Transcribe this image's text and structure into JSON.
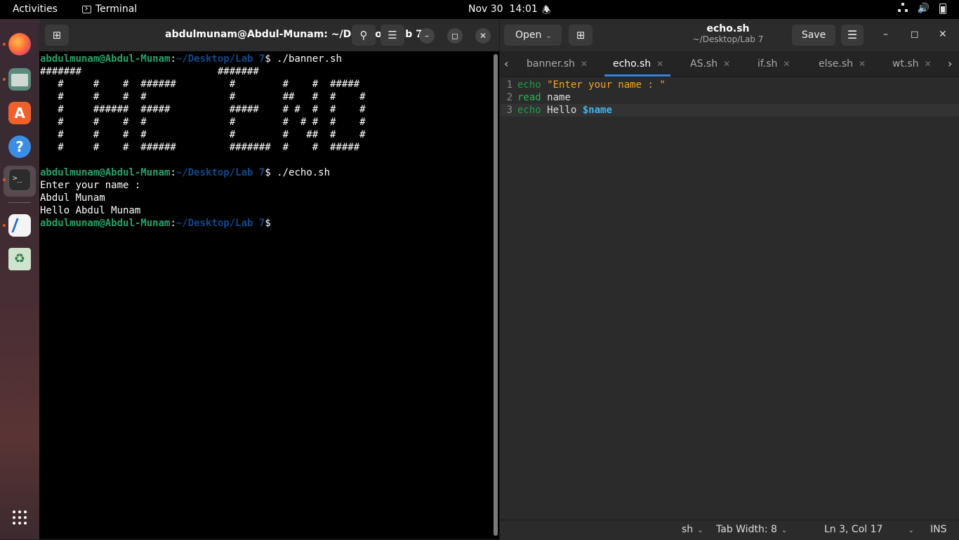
{
  "topbar": {
    "activities": "Activities",
    "app_name": "Terminal",
    "datetime": "Nov 30  14:01"
  },
  "dock": {
    "items": [
      "Firefox",
      "Files",
      "App Center",
      "Help",
      "Terminal",
      "Text Editor",
      "Trash"
    ]
  },
  "terminal": {
    "title": "abdulmunam@Abdul-Munam: ~/Desktop/Lab 7",
    "prompt_user": "abdulmunam@Abdul-Munam",
    "prompt_path": "~/Desktop/Lab 7",
    "cmd1": " ./banner.sh",
    "banner": [
      "#######                       #######",
      "   #     #    #  ######         #        #    #  #####",
      "   #     #    #  #              #        ##   #  #    #",
      "   #     ######  #####          #####    # #  #  #    #",
      "   #     #    #  #              #        #  # #  #    #",
      "   #     #    #  #              #        #   ##  #    #",
      "   #     #    #  ######         #######  #    #  #####"
    ],
    "cmd2": " ./echo.sh",
    "out1": "Enter your name :",
    "out2": "Abdul Munam",
    "out3": "Hello Abdul Munam"
  },
  "editor": {
    "open_label": "Open",
    "save_label": "Save",
    "file_name": "echo.sh",
    "file_path": "~/Desktop/Lab 7",
    "tabs": [
      {
        "label": "banner.sh"
      },
      {
        "label": "echo.sh"
      },
      {
        "label": "AS.sh"
      },
      {
        "label": "if.sh"
      },
      {
        "label": "else.sh"
      },
      {
        "label": "wt.sh"
      }
    ],
    "code": {
      "l1_kw": "echo",
      "l1_str": "\"Enter your name : \"",
      "l2_kw": "read",
      "l2_rest": "name",
      "l3_kw": "echo",
      "l3_plain": "Hello",
      "l3_var": "$name"
    },
    "status": {
      "language": "sh",
      "tab_width": "Tab Width: 8",
      "position": "Ln 3, Col 17",
      "mode": "INS"
    }
  }
}
